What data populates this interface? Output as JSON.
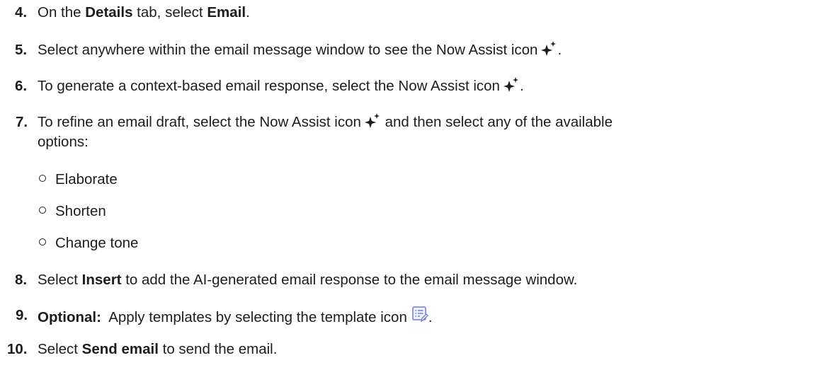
{
  "steps": [
    {
      "number": "4.",
      "before": "On the ",
      "bold1": "Details",
      "middle": " tab, select ",
      "bold2": "Email",
      "after": "."
    },
    {
      "number": "5.",
      "text": "Select anywhere within the email message window to see the Now Assist icon",
      "after": "."
    },
    {
      "number": "6.",
      "text": "To generate a context-based email response, select the Now Assist icon",
      "after": "."
    },
    {
      "number": "7.",
      "text": "To refine an email draft, select the Now Assist icon",
      "text2": " and then select any of the available",
      "line2": "options:",
      "options": [
        "Elaborate",
        "Shorten",
        "Change tone"
      ]
    },
    {
      "number": "8.",
      "before": "Select ",
      "bold": "Insert",
      "after": " to add the AI-generated email response to the email message window."
    },
    {
      "number": "9.",
      "bold": "Optional:",
      "text": "  Apply templates by selecting the template icon",
      "after": "."
    },
    {
      "number": "10.",
      "before": "Select ",
      "bold": "Send email",
      "after": " to send the email."
    }
  ],
  "icons": {
    "sparkle": "now-assist-sparkle-icon",
    "template": "template-icon",
    "template_color": "#6f7fd6"
  }
}
